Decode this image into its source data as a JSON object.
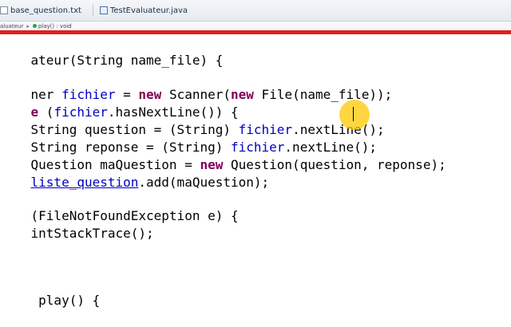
{
  "tabs": [
    {
      "label": "base_question.txt",
      "icon": "text-file-icon"
    },
    {
      "label": "TestEvaluateur.java",
      "icon": "java-file-icon"
    }
  ],
  "breadcrumb": {
    "class_label": "aluateur",
    "method_label": "play() : void"
  },
  "colors": {
    "accent_bar": "#e21f1f",
    "keyword": "#7f0055",
    "field": "#0000c0"
  },
  "code": {
    "l1": {
      "t1": "ateur(String name_file) {"
    },
    "l2": {
      "t1": "ner ",
      "t2": "fichier",
      "t3": " = ",
      "t4": "new",
      "t5": " Scanner(",
      "t6": "new",
      "t7": " File(name_file));"
    },
    "l3": {
      "t1": "e",
      "t2": " (",
      "t3": "fichier",
      "t4": ".hasNextLine()) {"
    },
    "l4": {
      "t1": "String question = (String) ",
      "t2": "fichier",
      "t3": ".nextLine();"
    },
    "l5": {
      "t1": "String reponse = (String) ",
      "t2": "fichier",
      "t3": ".nextLine();"
    },
    "l6": {
      "t1": "Question maQuestion = ",
      "t2": "new",
      "t3": " Question(question, reponse);"
    },
    "l7": {
      "t1": "liste_question",
      "t2": ".add(maQuestion);"
    },
    "l8": {
      "t1": "(FileNotFoundException e) {"
    },
    "l9": {
      "t1": "intStackTrace();"
    },
    "l10": {
      "t1": " play() {"
    }
  }
}
